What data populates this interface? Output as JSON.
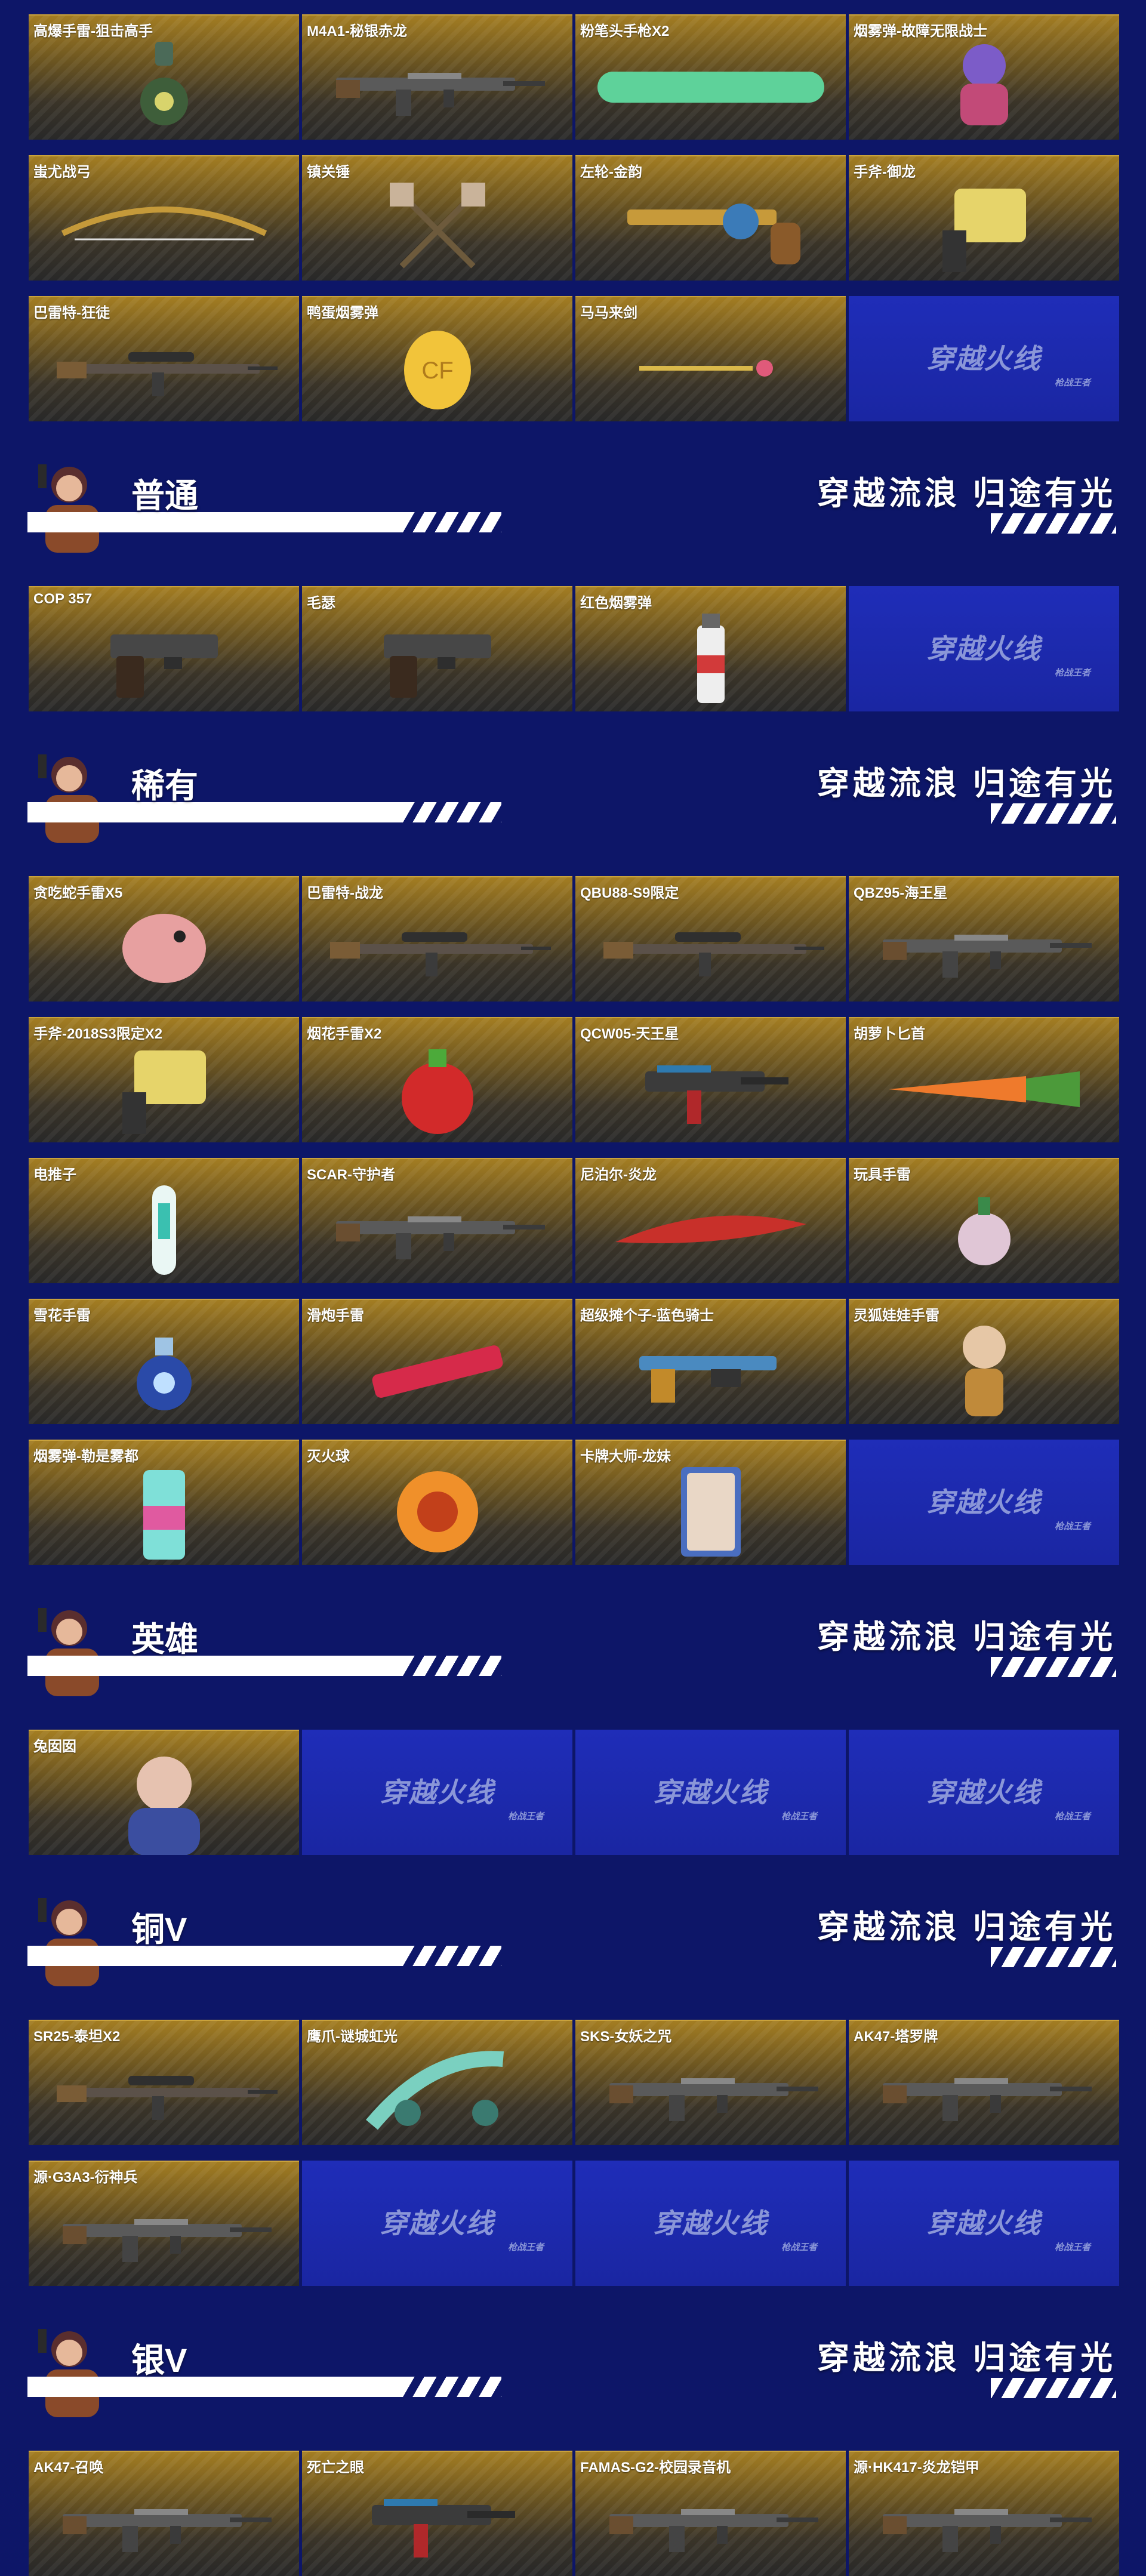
{
  "slogan": "穿越流浪 归途有光",
  "logo": {
    "main": "穿越火线",
    "sub": "枪战王者"
  },
  "colors": {
    "page_background": "#0d1668",
    "card_gold": "#a37d22",
    "card_dark": "#282828",
    "logo_card_blue": "#1f2db8"
  },
  "sections": [
    {
      "title": "",
      "items": [
        {
          "name": "高爆手雷-狙击高手",
          "icon": "grenade-icon"
        },
        {
          "name": "M4A1-秘银赤龙",
          "icon": "rifle-icon"
        },
        {
          "name": "粉笔头手枪X2",
          "icon": "chalk-icon"
        },
        {
          "name": "烟雾弹-故障无限战士",
          "icon": "figure-icon"
        },
        {
          "name": "蚩尤战弓",
          "icon": "bow-icon"
        },
        {
          "name": "镇关锤",
          "icon": "hammer-icon"
        },
        {
          "name": "左轮-金韵",
          "icon": "revolver-icon"
        },
        {
          "name": "手斧-御龙",
          "icon": "axe-icon"
        },
        {
          "name": "巴雷特-狂徒",
          "icon": "sniper-icon"
        },
        {
          "name": "鸭蛋烟雾弹",
          "icon": "egg-icon"
        },
        {
          "name": "马马来剑",
          "icon": "sword-icon"
        },
        {
          "name": "",
          "logo": true
        }
      ]
    },
    {
      "title": "普通",
      "items": [
        {
          "name": "COP 357",
          "icon": "pistol-icon"
        },
        {
          "name": "毛瑟",
          "icon": "pistol-icon"
        },
        {
          "name": "红色烟雾弹",
          "icon": "smoke-grenade-icon"
        },
        {
          "name": "",
          "logo": true
        }
      ]
    },
    {
      "title": "稀有",
      "items": [
        {
          "name": "贪吃蛇手雷X5",
          "icon": "fish-icon"
        },
        {
          "name": "巴雷特-战龙",
          "icon": "sniper-icon"
        },
        {
          "name": "QBU88-S9限定",
          "icon": "sniper-icon"
        },
        {
          "name": "QBZ95-海王星",
          "icon": "rifle-icon"
        },
        {
          "name": "手斧-2018S3限定X2",
          "icon": "axe-icon"
        },
        {
          "name": "烟花手雷X2",
          "icon": "bomb-icon"
        },
        {
          "name": "QCW05-天王星",
          "icon": "smg-icon"
        },
        {
          "name": "胡萝卜匕首",
          "icon": "carrot-icon"
        },
        {
          "name": "电推子",
          "icon": "clipper-icon"
        },
        {
          "name": "SCAR-守护者",
          "icon": "rifle-icon"
        },
        {
          "name": "尼泊尔-炎龙",
          "icon": "knife-icon"
        },
        {
          "name": "玩具手雷",
          "icon": "toy-grenade-icon"
        },
        {
          "name": "雪花手雷",
          "icon": "snow-grenade-icon"
        },
        {
          "name": "滑炮手雷",
          "icon": "firecracker-icon"
        },
        {
          "name": "超级摊个子-蓝色骑士",
          "icon": "shotgun-icon"
        },
        {
          "name": "灵狐娃娃手雷",
          "icon": "doll-icon"
        },
        {
          "name": "烟雾弹-勒是雾都",
          "icon": "can-icon"
        },
        {
          "name": "灭火球",
          "icon": "ball-icon"
        },
        {
          "name": "卡牌大师-龙妹",
          "icon": "card-icon"
        },
        {
          "name": "",
          "logo": true
        }
      ]
    },
    {
      "title": "英雄",
      "items": [
        {
          "name": "兔囡囡",
          "icon": "character-icon"
        },
        {
          "name": "",
          "logo": true
        },
        {
          "name": "",
          "logo": true
        },
        {
          "name": "",
          "logo": true
        }
      ]
    },
    {
      "title": "铜V",
      "items": [
        {
          "name": "SR25-泰坦X2",
          "icon": "sniper-icon"
        },
        {
          "name": "鹰爪-谜城虹光",
          "icon": "claw-icon"
        },
        {
          "name": "SKS-女妖之咒",
          "icon": "rifle-icon"
        },
        {
          "name": "AK47-塔罗牌",
          "icon": "rifle-icon"
        },
        {
          "name": "源·G3A3-衍神兵",
          "icon": "rifle-icon"
        },
        {
          "name": "",
          "logo": true
        },
        {
          "name": "",
          "logo": true
        },
        {
          "name": "",
          "logo": true
        }
      ]
    },
    {
      "title": "银V",
      "items": [
        {
          "name": "AK47-召唤",
          "icon": "rifle-icon"
        },
        {
          "name": "死亡之眼",
          "icon": "smg-icon"
        },
        {
          "name": "FAMAS-G2-校园录音机",
          "icon": "rifle-icon"
        },
        {
          "name": "源·HK417-炎龙铠甲",
          "icon": "rifle-icon"
        }
      ]
    }
  ]
}
